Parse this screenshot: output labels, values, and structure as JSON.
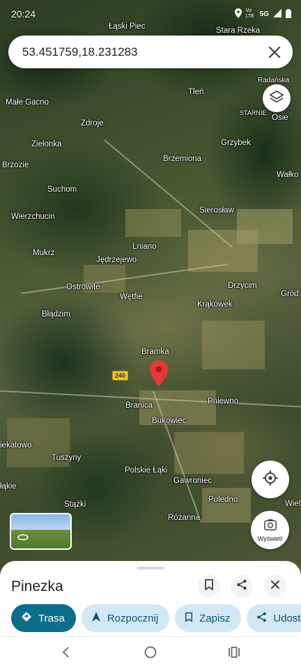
{
  "status_bar": {
    "time": "20:24",
    "network": "Vo LTE",
    "signal": "5G"
  },
  "search": {
    "value": "53.451759,18.231283"
  },
  "map": {
    "places": [
      {
        "name": "Łąski Piec"
      },
      {
        "name": "Stara Rzeka"
      },
      {
        "name": "Radańska"
      },
      {
        "name": "Tleń"
      },
      {
        "name": "Małe Gacno"
      },
      {
        "name": "STARNIE"
      },
      {
        "name": "Osie"
      },
      {
        "name": "Zdroje"
      },
      {
        "name": "Zielonka"
      },
      {
        "name": "Grzybek"
      },
      {
        "name": "Brzemiona"
      },
      {
        "name": "Brzozie"
      },
      {
        "name": "Wałko"
      },
      {
        "name": "Suchom"
      },
      {
        "name": "Sierosław"
      },
      {
        "name": "Wierzchucin"
      },
      {
        "name": "Lniano"
      },
      {
        "name": "Mukrz"
      },
      {
        "name": "Jędrzejewo"
      },
      {
        "name": "Ostrowite"
      },
      {
        "name": "Drzycim"
      },
      {
        "name": "Gród"
      },
      {
        "name": "Wętfie"
      },
      {
        "name": "Krąkówek"
      },
      {
        "name": "Błądzim"
      },
      {
        "name": "Bramka"
      },
      {
        "name": "Branica"
      },
      {
        "name": "Pniewno"
      },
      {
        "name": "Bukowiec"
      },
      {
        "name": "Polskie Łąki"
      },
      {
        "name": "Tuszyny"
      },
      {
        "name": "Gawroniec"
      },
      {
        "name": "Stążki"
      },
      {
        "name": "Poledno"
      },
      {
        "name": "Różanna"
      },
      {
        "name": "Wiel"
      },
      {
        "name": "iekatowo"
      },
      {
        "name": "łąkie"
      }
    ],
    "road_number": "240"
  },
  "view_button_label": "Wyświetl",
  "sheet": {
    "title": "Pinezka",
    "actions": [
      {
        "label": "Trasa"
      },
      {
        "label": "Rozpocznij"
      },
      {
        "label": "Zapisz"
      },
      {
        "label": "Udost"
      }
    ]
  },
  "colors": {
    "accent": "#0b6e8a",
    "chip_bg": "#d3e8f5",
    "pin": "#e53935"
  }
}
